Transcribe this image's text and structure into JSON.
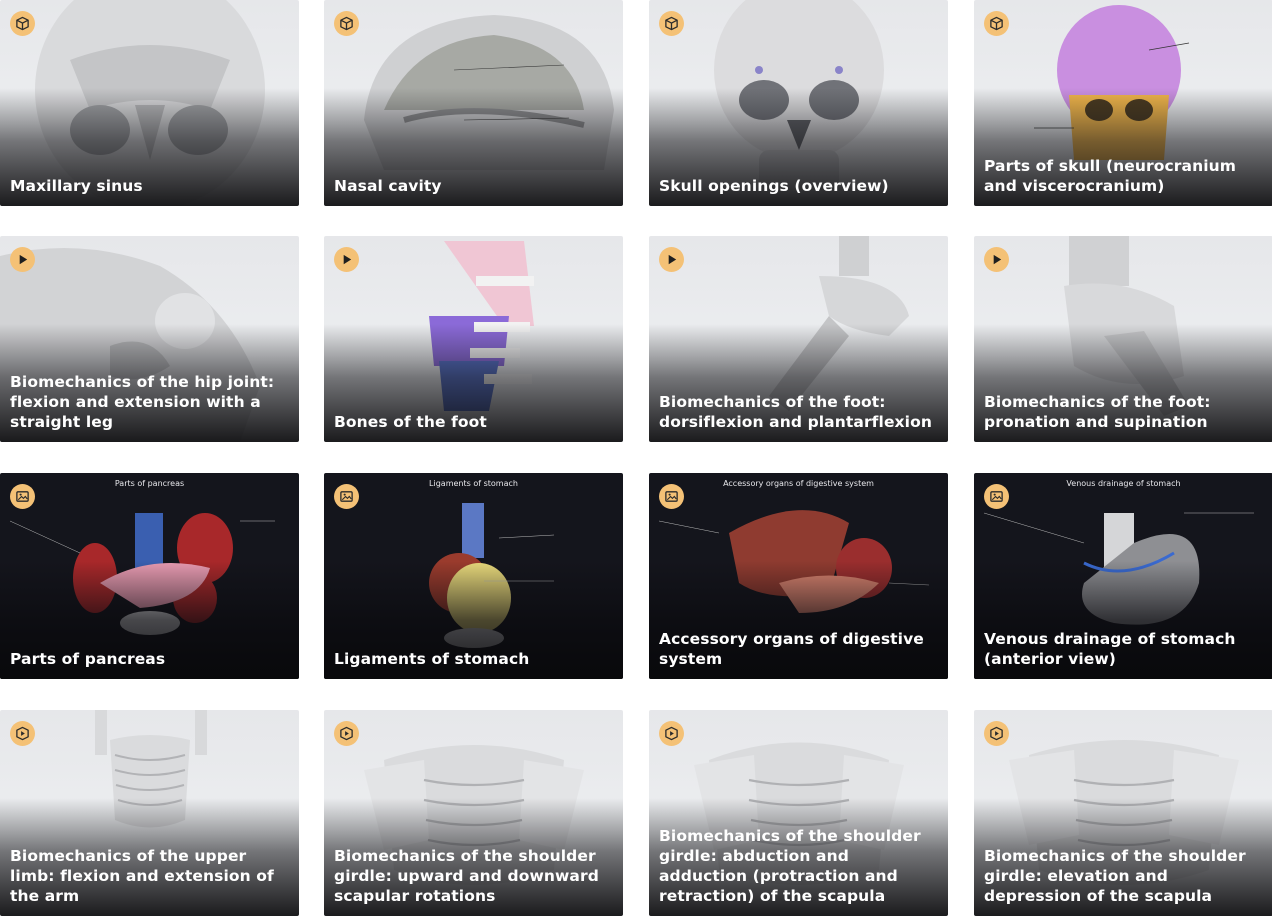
{
  "cards": [
    {
      "title": "Maxillary sinus",
      "type": "3d-model",
      "icon": "cube-icon"
    },
    {
      "title": "Nasal cavity",
      "type": "3d-model",
      "icon": "cube-icon"
    },
    {
      "title": "Skull openings (overview)",
      "type": "3d-model",
      "icon": "cube-icon"
    },
    {
      "title": "Parts of skull (neurocranium and viscerocranium)",
      "type": "3d-model",
      "icon": "cube-icon"
    },
    {
      "title": "Biomechanics of the hip joint: flexion and extension with a straight leg",
      "type": "video",
      "icon": "play-icon"
    },
    {
      "title": "Bones of the foot",
      "type": "video",
      "icon": "play-icon"
    },
    {
      "title": "Biomechanics of the foot: dorsiflexion and plantarflexion",
      "type": "video",
      "icon": "play-icon"
    },
    {
      "title": "Biomechanics of the foot: pronation and supination",
      "type": "video",
      "icon": "play-icon"
    },
    {
      "title": "Parts of pancreas",
      "type": "image",
      "icon": "image-icon",
      "diagram_title": "Parts of pancreas"
    },
    {
      "title": "Ligaments of stomach",
      "type": "image",
      "icon": "image-icon",
      "diagram_title": "Ligaments of stomach"
    },
    {
      "title": "Accessory organs of digestive system",
      "type": "image",
      "icon": "image-icon",
      "diagram_title": "Accessory organs of digestive system"
    },
    {
      "title": "Venous drainage of stomach (anterior view)",
      "type": "image",
      "icon": "image-icon",
      "diagram_title": "Venous drainage of stomach"
    },
    {
      "title": "Biomechanics of the upper limb: flexion and extension of the arm",
      "type": "animation",
      "icon": "cube-play-icon"
    },
    {
      "title": "Biomechanics of the shoulder girdle: upward and downward scapular rotations",
      "type": "animation",
      "icon": "cube-play-icon"
    },
    {
      "title": "Biomechanics of the shoulder girdle: abduction and adduction (protraction and retraction) of the scapula",
      "type": "animation",
      "icon": "cube-play-icon"
    },
    {
      "title": "Biomechanics of the shoulder girdle: elevation and depression of the scapula",
      "type": "animation",
      "icon": "cube-play-icon"
    }
  ],
  "colors": {
    "badge": "#f4c176",
    "badge_icon": "#2b2b2b",
    "light_card": "#e6e7ea",
    "dark_card": "#14151c",
    "neurocranium": "#c98fe0",
    "viscerocranium": "#f0b54a"
  }
}
